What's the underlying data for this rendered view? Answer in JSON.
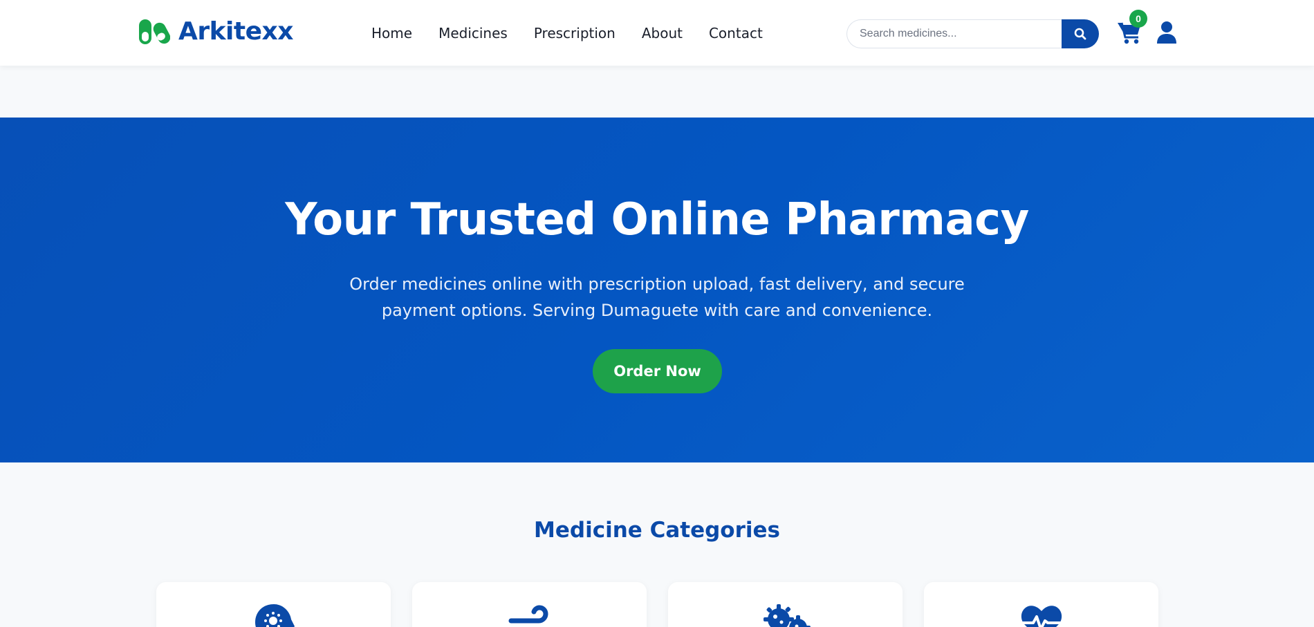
{
  "brand": {
    "name": "Arkitexx",
    "accent": "#0b4aa8",
    "logo_color": "#19a64b"
  },
  "nav": {
    "links": [
      {
        "label": "Home"
      },
      {
        "label": "Medicines"
      },
      {
        "label": "Prescription"
      },
      {
        "label": "About"
      },
      {
        "label": "Contact"
      }
    ]
  },
  "search": {
    "placeholder": "Search medicines...",
    "icon": "search-icon"
  },
  "cart": {
    "count": "0",
    "icon": "cart-icon"
  },
  "user": {
    "icon": "user-icon"
  },
  "hero": {
    "title": "Your Trusted Online Pharmacy",
    "subtitle": "Order medicines online with prescription upload, fast delivery, and secure payment options. Serving Dumaguete with care and convenience.",
    "cta_label": "Order Now",
    "background": "#0556bf",
    "cta_color": "#1ea24a"
  },
  "categories": {
    "title": "Medicine Categories",
    "items": [
      {
        "icon": "virus-head-icon"
      },
      {
        "icon": "wind-icon"
      },
      {
        "icon": "bacteria-icon"
      },
      {
        "icon": "heart-pulse-icon"
      }
    ]
  }
}
